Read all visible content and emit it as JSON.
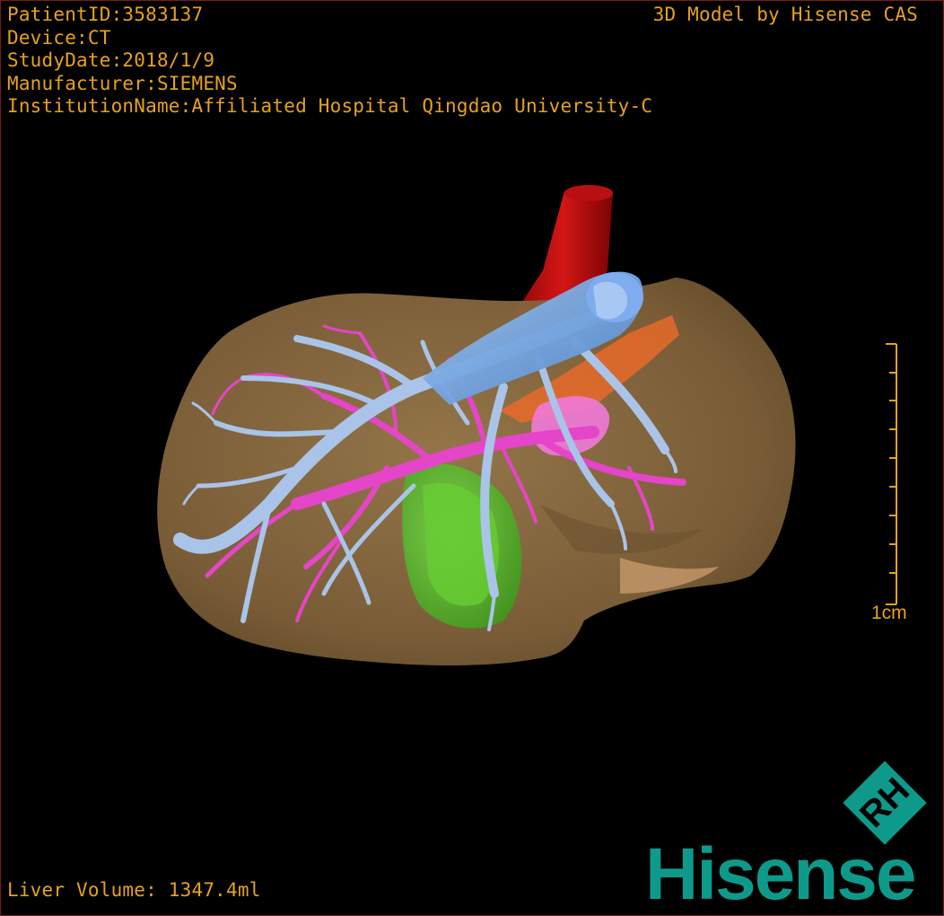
{
  "viewer": {
    "patient_id": "PatientID:3583137",
    "device": "Device:CT",
    "study_date": "StudyDate:2018/1/9",
    "manufacturer": "Manufacturer:SIEMENS",
    "institution": "InstitutionName:Affiliated Hospital Qingdao University-C",
    "credit": "3D Model by Hisense CAS",
    "liver_volume": "Liver Volume: 1347.4ml",
    "scale_label": "1cm"
  },
  "brand": {
    "name": "Hisense",
    "mark": "RH"
  },
  "colors": {
    "overlay_text": "#e6a21d",
    "liver": "#8a6a3f",
    "hepatic_vein": "#a9c4e8",
    "portal_vein": "#e545c8",
    "ivc": "#6ea3e6",
    "aorta": "#c01010",
    "gallbladder": "#5cc22a",
    "tumor": "#e86a2a",
    "brand": "#0e9a8a"
  }
}
